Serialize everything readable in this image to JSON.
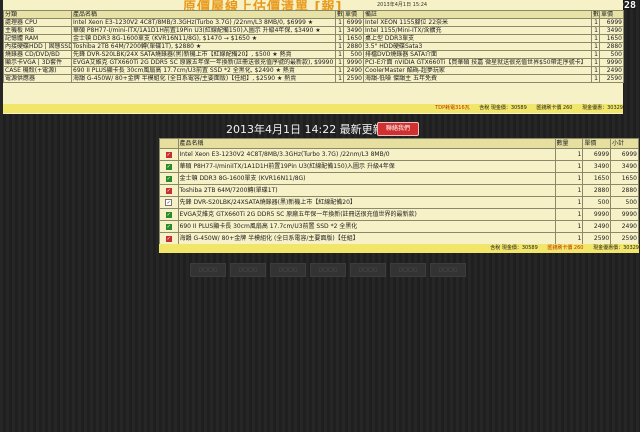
{
  "watermark": "#1900928",
  "top": {
    "title": "原價屋線上估價清單 [報]",
    "timestamp": "2013年4月1日 15:24",
    "headers": {
      "cat": "分類",
      "name": "產品名稱",
      "qty": "數",
      "price": "單價",
      "note": "備註",
      "qty2": "數",
      "price2": "單價"
    },
    "rows": [
      {
        "cat": "處理器 CPU",
        "name": "Intel Xeon E3-1230V2 4C8T/8MB/3.3GHz(Turbo 3.7G) /22nm/L3 8MB/0, $6999 ★",
        "qty": "1",
        "price": "6999",
        "note": "Intel XEON 1155腳位 22奈米",
        "qty2": "1",
        "price2": "6999"
      },
      {
        "cat": "主機板 MB",
        "name": "華碩 P8H77-I/mini-ITX/1A1D1H前置19Pin U3(紅線配備150)入圖示 升級4年保, $3490 ★",
        "qty": "1",
        "price": "3490",
        "note": "Intel 1155/Mini-ITX/含擴充",
        "qty2": "1",
        "price2": "3490"
      },
      {
        "cat": "記憶體 RAM",
        "name": "金士頓 DDR3 8G-1600單支 (KVR16N11/8G), $1470 → $1650 ★",
        "qty": "1",
        "price": "1650",
        "note": "桌上型 DDR3單支",
        "qty2": "1",
        "price2": "1650"
      },
      {
        "cat": "內接硬碟HDD | 固態SSD",
        "name": "Toshiba 2TB 64M/7200轉(單碟1T), $2880 ★",
        "qty": "1",
        "price": "2880",
        "note": "3.5\" HDD硬碟Sata3",
        "qty2": "1",
        "price2": "2880"
      },
      {
        "cat": "燒錄器 CD/DVD/BD",
        "name": "先鋒 DVR-S20LBK/24X SATA燒錄器(黑)新機上市【紅線配備20】, $500 ★ 熱賣",
        "qty": "1",
        "price": "500",
        "note": "排檔DVD燒錄器 SATA介面",
        "qty2": "1",
        "price2": "500"
      },
      {
        "cat": "顯示卡VGA | 3D套件",
        "name": "EVGA艾維克 GTX660Ti 2G DDR5 SC 原廠五年保一年換新(註冊送很充值序號的最新款), $9990 ★ 熱賣",
        "qty": "1",
        "price": "9990",
        "note": "PCI-E介面 nVIDIA GTX660Ti【買華碩 技嘉 微星就送很充值世界$50帶走序號卡】",
        "qty2": "1",
        "price2": "9990"
      },
      {
        "cat": "CASE 機殼(+電源)",
        "name": "690 II PLUS顯卡長 30cm風扇高 17.7cm/U3前置 SSD *2 全黑化, $2490 ★ 熱賣",
        "qty": "1",
        "price": "2490",
        "note": "CoolerMaster 酷碼-超夢玩家",
        "qty2": "1",
        "price2": "2490"
      },
      {
        "cat": "電源供應器",
        "name": "海韻 G-450W/ 80+金牌 半模組化 (全日系電容/主要面版)【任組】, $2590 ★ 熱賣",
        "qty": "1",
        "price": "2590",
        "note": "海韻-低噪 傑韻主 五年免費",
        "qty2": "1",
        "price2": "2590"
      }
    ],
    "tags": {
      "vga": "熱賣",
      "case": "熱賣"
    },
    "summary": {
      "tdp": "TDP耗電316瓦",
      "cash": "含稅 現金價：30589",
      "mail": "匯錢刷卡價 260",
      "total": "現金優惠：30329"
    }
  },
  "heading": "2013年4月1日 14:22 最新更新價格",
  "contact_button": "聯絡我們",
  "list": {
    "headers": {
      "name": "產品名稱",
      "qty": "數量",
      "price": "單價",
      "sub": "小計"
    },
    "rows": [
      {
        "check": "✓",
        "color": "red",
        "name": "Intel Xeon E3-1230V2 4C8T/8MB/3.3GHz(Turbo 3.7G) /22nm/L3 8MB/0",
        "qty": "1",
        "price": "6999",
        "sub": "6999"
      },
      {
        "check": "✓",
        "color": "green",
        "name": "華碩 P8H77-I/miniITX/1A1D1H前置19Pin U3(紅線配備150)入圖示 升級4年保",
        "qty": "1",
        "price": "3490",
        "sub": "3490"
      },
      {
        "check": "✓",
        "color": "green",
        "name": "金士頓 DDR3 8G-1600單支 (KVR16N11/8G)",
        "qty": "1",
        "price": "1650",
        "sub": "1650"
      },
      {
        "check": "✓",
        "color": "red",
        "name": "Toshiba 2TB 64M/7200轉(單碟1T)",
        "qty": "1",
        "price": "2880",
        "sub": "2880"
      },
      {
        "check": "✓",
        "color": "white",
        "name": "先鋒 DVR-S20LBK/24XSATA燒錄器(黑)新機上市【紅線配備20】",
        "qty": "1",
        "price": "500",
        "sub": "500"
      },
      {
        "check": "✓",
        "color": "green",
        "name": "EVGA艾維克 GTX660Ti 2G DDR5 SC 原廠五年保一年換新(註冊送很充值世界的最新款)",
        "qty": "1",
        "price": "9990",
        "sub": "9990"
      },
      {
        "check": "✓",
        "color": "green",
        "name": "690 II PLUS顯卡長 30cm風扇高 17.7cm/U3前置 SSD *2 全黑化",
        "qty": "1",
        "price": "2490",
        "sub": "2490"
      },
      {
        "check": "✓",
        "color": "red",
        "name": "海韻 G-450W/ 80+金牌 半模組化 (全日系電容/主要面版)【任組】",
        "qty": "1",
        "price": "2590",
        "sub": "2590"
      }
    ],
    "summary": {
      "cash": "含稅 現金價：30589",
      "mail": "匯錢刷卡價 260",
      "total": "現金優惠價：30329"
    }
  },
  "ghost_buttons": [
    "▢▢▢▢",
    "▢▢▢▢",
    "▢▢▢▢",
    "▢▢▢▢",
    "▢▢▢▢",
    "▢▢▢▢",
    "▢▢▢▢"
  ]
}
